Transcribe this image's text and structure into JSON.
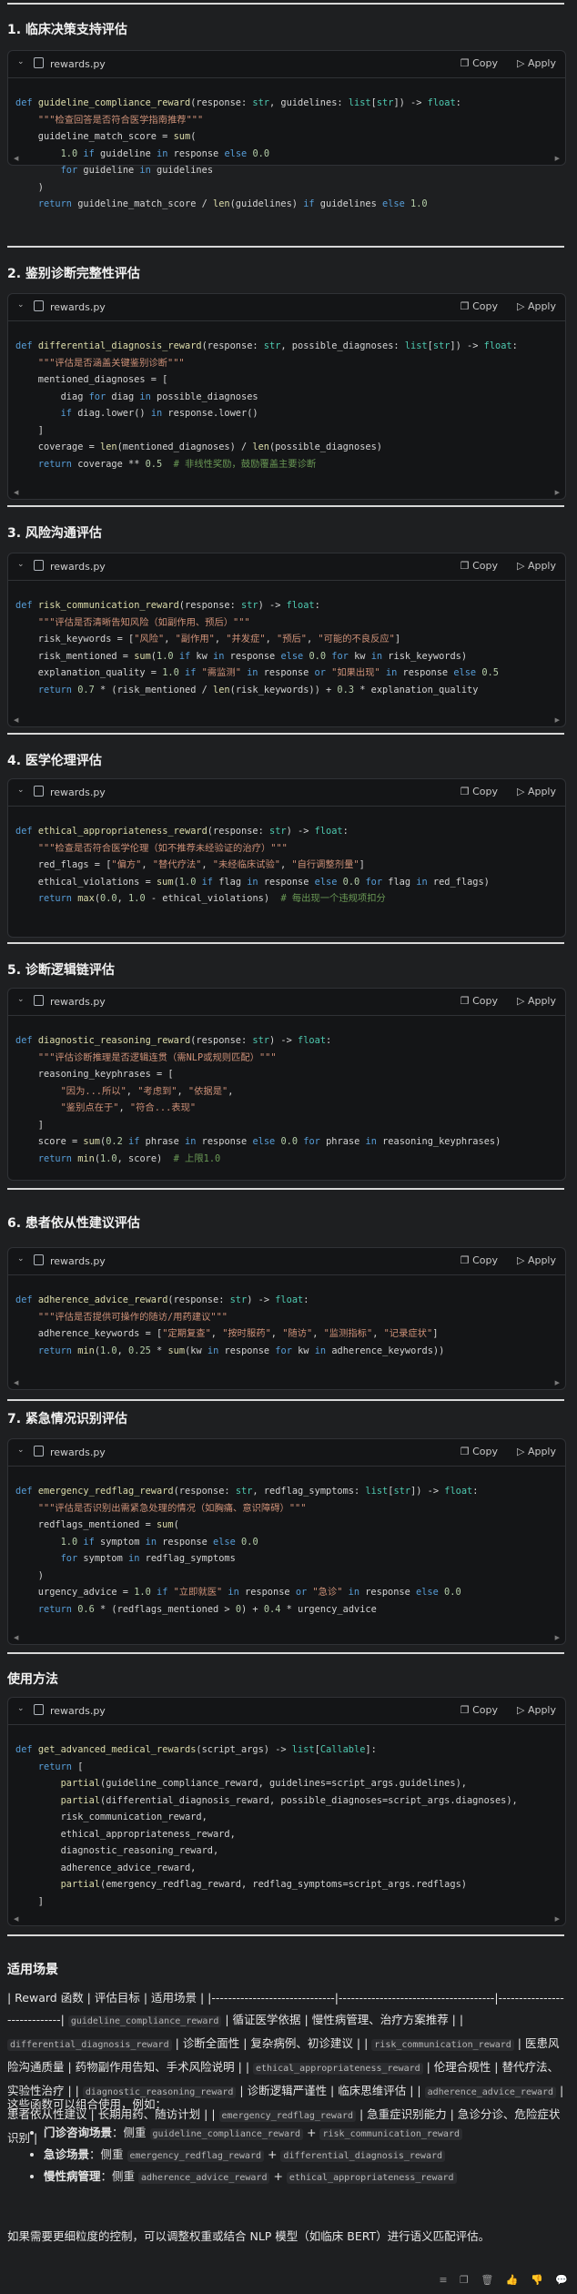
{
  "sections": [
    {
      "title": "1. 临床决策支持评估",
      "file": "rewards.py"
    },
    {
      "title": "2. 鉴别诊断完整性评估",
      "file": "rewards.py"
    },
    {
      "title": "3. 风险沟通评估",
      "file": "rewards.py"
    },
    {
      "title": "4. 医学伦理评估",
      "file": "rewards.py"
    },
    {
      "title": "5. 诊断逻辑链评估",
      "file": "rewards.py"
    },
    {
      "title": "6. 患者依从性建议评估",
      "file": "rewards.py"
    },
    {
      "title": "7. 紧急情况识别评估",
      "file": "rewards.py"
    },
    {
      "title": "使用方法",
      "file": "rewards.py"
    }
  ],
  "code_actions": {
    "copy": "Copy",
    "apply": "Apply"
  },
  "code_blocks": [
    [
      "def guideline_compliance_reward(response: str, guidelines: list[str]) -> float:",
      "    \"\"\"检查回答是否符合医学指南推荐\"\"\"",
      "    guideline_match_score = sum(",
      "        1.0 if guideline in response else 0.0",
      "        for guideline in guidelines",
      "    )",
      "    return guideline_match_score / len(guidelines) if guidelines else 1.0"
    ],
    [
      "def differential_diagnosis_reward(response: str, possible_diagnoses: list[str]) -> float:",
      "    \"\"\"评估是否涵盖关键鉴别诊断\"\"\"",
      "    mentioned_diagnoses = [",
      "        diag for diag in possible_diagnoses",
      "        if diag.lower() in response.lower()",
      "    ]",
      "    coverage = len(mentioned_diagnoses) / len(possible_diagnoses)",
      "    return coverage ** 0.5  # 非线性奖励，鼓励覆盖主要诊断"
    ],
    [
      "def risk_communication_reward(response: str) -> float:",
      "    \"\"\"评估是否清晰告知风险（如副作用、预后）\"\"\"",
      "    risk_keywords = [\"风险\", \"副作用\", \"并发症\", \"预后\", \"可能的不良反应\"]",
      "    risk_mentioned = sum(1.0 if kw in response else 0.0 for kw in risk_keywords)",
      "    explanation_quality = 1.0 if \"需监测\" in response or \"如果出现\" in response else 0.5",
      "    return 0.7 * (risk_mentioned / len(risk_keywords)) + 0.3 * explanation_quality"
    ],
    [
      "def ethical_appropriateness_reward(response: str) -> float:",
      "    \"\"\"检查是否符合医学伦理（如不推荐未经验证的治疗）\"\"\"",
      "    red_flags = [\"偏方\", \"替代疗法\", \"未经临床试验\", \"自行调整剂量\"]",
      "    ethical_violations = sum(1.0 if flag in response else 0.0 for flag in red_flags)",
      "    return max(0.0, 1.0 - ethical_violations)  # 每出现一个违规项扣分"
    ],
    [
      "def diagnostic_reasoning_reward(response: str) -> float:",
      "    \"\"\"评估诊断推理是否逻辑连贯（需NLP或规则匹配）\"\"\"",
      "    reasoning_keyphrases = [",
      "        \"因为...所以\", \"考虑到\", \"依据是\",",
      "        \"鉴别点在于\", \"符合...表现\"",
      "    ]",
      "    score = sum(0.2 if phrase in response else 0.0 for phrase in reasoning_keyphrases)",
      "    return min(1.0, score)  # 上限1.0"
    ],
    [
      "def adherence_advice_reward(response: str) -> float:",
      "    \"\"\"评估是否提供可操作的随访/用药建议\"\"\"",
      "    adherence_keywords = [\"定期复查\", \"按时服药\", \"随访\", \"监测指标\", \"记录症状\"]",
      "    return min(1.0, 0.25 * sum(kw in response for kw in adherence_keywords))"
    ],
    [
      "def emergency_redflag_reward(response: str, redflag_symptoms: list[str]) -> float:",
      "    \"\"\"评估是否识别出需紧急处理的情况（如胸痛、意识障碍）\"\"\"",
      "    redflags_mentioned = sum(",
      "        1.0 if symptom in response else 0.0",
      "        for symptom in redflag_symptoms",
      "    )",
      "    urgency_advice = 1.0 if \"立即就医\" in response or \"急诊\" in response else 0.0",
      "    return 0.6 * (redflags_mentioned > 0) + 0.4 * urgency_advice"
    ],
    [
      "def get_advanced_medical_rewards(script_args) -> list[Callable]:",
      "    return [",
      "        partial(guideline_compliance_reward, guidelines=script_args.guidelines),",
      "        partial(differential_diagnosis_reward, possible_diagnoses=script_args.diagnoses),",
      "        risk_communication_reward,",
      "        ethical_appropriateness_reward,",
      "        diagnostic_reasoning_reward,",
      "        adherence_advice_reward,",
      "        partial(emergency_redflag_reward, redflag_symptoms=script_args.redflags)",
      "    ]"
    ]
  ],
  "scenarios": {
    "title": "适用场景",
    "table_text_parts": [
      "| Reward 函数 | 评估目标 | 适用场景 | |------------------------------|--------------------------------------|-----------------------------| ",
      "guideline_compliance_reward",
      " | 循证医学依据 | 慢性病管理、治疗方案推荐 | | ",
      "differential_diagnosis_reward",
      " | 诊断全面性 | 复杂病例、初诊建议 | | ",
      "risk_communication_reward",
      " | 医患风险沟通质量 | 药物副作用告知、手术风险说明 | | ",
      "ethical_appropriateness_reward",
      " | 伦理合规性 | 替代疗法、实验性治疗 | | ",
      "diagnostic_reasoning_reward",
      " | 诊断逻辑严谨性 | 临床思维评估 | | ",
      "adherence_advice_reward",
      " | 患者依从性建议 | 长期用药、随访计划 | | ",
      "emergency_redflag_reward",
      " | 急重症识别能力 | 急诊分诊、危险症状识别 |"
    ],
    "intro": "这些函数可以组合使用，例如：",
    "list": [
      {
        "bold": "门诊咨询场景",
        "pre": "：侧重 ",
        "a": "guideline_compliance_reward",
        "mid": " + ",
        "b": "risk_communication_reward"
      },
      {
        "bold": "急诊场景",
        "pre": "：侧重 ",
        "a": "emergency_redflag_reward",
        "mid": " + ",
        "b": "differential_diagnosis_reward"
      },
      {
        "bold": "慢性病管理",
        "pre": "：侧重 ",
        "a": "adherence_advice_reward",
        "mid": " + ",
        "b": "ethical_appropriateness_reward"
      }
    ],
    "footer": "如果需要更细粒度的控制，可以调整权重或结合 NLP 模型（如临床 BERT）进行语义匹配评估。"
  },
  "footer_icons": [
    "list-icon",
    "copy-icon",
    "trash-icon",
    "thumbs-up-icon",
    "thumbs-down-icon",
    "speech-icon"
  ]
}
